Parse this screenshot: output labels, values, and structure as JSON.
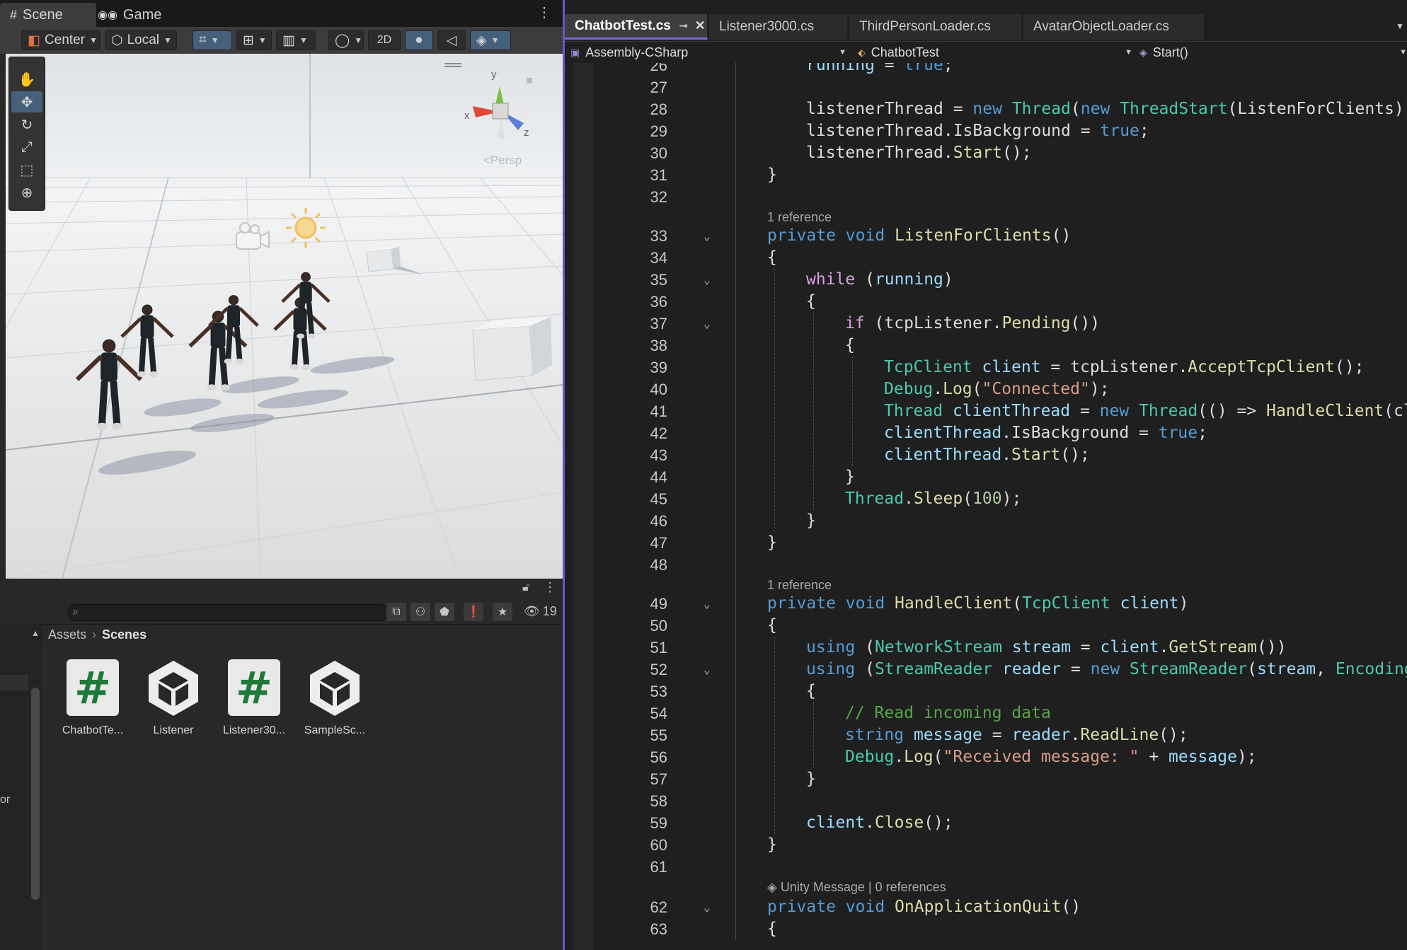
{
  "unity": {
    "tabs": {
      "scene": "Scene",
      "game": "Game"
    },
    "toolbar": {
      "pivot": "Center",
      "space": "Local",
      "mode2d": "2D"
    },
    "viewport": {
      "projection": "<Persp",
      "axis_x": "x",
      "axis_y": "y",
      "axis_z": "z"
    },
    "project": {
      "hidden_count": "19",
      "breadcrumb": {
        "root": "Assets",
        "current": "Scenes"
      },
      "assets": [
        {
          "name": "ChatbotTe...",
          "icon": "csharp-script-icon"
        },
        {
          "name": "Listener",
          "icon": "unity-scene-icon"
        },
        {
          "name": "Listener30...",
          "icon": "csharp-script-icon"
        },
        {
          "name": "SampleSc...",
          "icon": "unity-scene-icon"
        }
      ],
      "side_label": "or"
    }
  },
  "vs": {
    "tabs": [
      {
        "label": "ChatbotTest.cs",
        "active": true
      },
      {
        "label": "Listener3000.cs"
      },
      {
        "label": "ThirdPersonLoader.cs"
      },
      {
        "label": "AvatarObjectLoader.cs"
      }
    ],
    "nav": {
      "project": "Assembly-CSharp",
      "type": "ChatbotTest",
      "member": "Start()"
    },
    "lens": {
      "ref1": "1 reference",
      "ref2": "1 reference",
      "unity_message": "Unity Message | 0 references"
    },
    "lines": [
      {
        "n": "26",
        "text": "running = true;"
      },
      {
        "n": "27",
        "text": ""
      },
      {
        "n": "28",
        "text": "listenerThread = new Thread(new ThreadStart(ListenForClients));"
      },
      {
        "n": "29",
        "text": "listenerThread.IsBackground = true;"
      },
      {
        "n": "30",
        "text": "listenerThread.Start();"
      },
      {
        "n": "31",
        "text": "}"
      },
      {
        "n": "32",
        "text": ""
      },
      {
        "n": "33",
        "text": "private void ListenForClients()"
      },
      {
        "n": "34",
        "text": "{"
      },
      {
        "n": "35",
        "text": "while (running)"
      },
      {
        "n": "36",
        "text": "{"
      },
      {
        "n": "37",
        "text": "if (tcpListener.Pending())"
      },
      {
        "n": "38",
        "text": "{"
      },
      {
        "n": "39",
        "text": "TcpClient client = tcpListener.AcceptTcpClient();"
      },
      {
        "n": "40",
        "text": "Debug.Log(\"Connected\");"
      },
      {
        "n": "41",
        "text": "Thread clientThread = new Thread(() => HandleClient(cl"
      },
      {
        "n": "42",
        "text": "clientThread.IsBackground = true;"
      },
      {
        "n": "43",
        "text": "clientThread.Start();"
      },
      {
        "n": "44",
        "text": "}"
      },
      {
        "n": "45",
        "text": "Thread.Sleep(100);"
      },
      {
        "n": "46",
        "text": "}"
      },
      {
        "n": "47",
        "text": "}"
      },
      {
        "n": "48",
        "text": ""
      },
      {
        "n": "49",
        "text": "private void HandleClient(TcpClient client)"
      },
      {
        "n": "50",
        "text": "{"
      },
      {
        "n": "51",
        "text": "using (NetworkStream stream = client.GetStream())"
      },
      {
        "n": "52",
        "text": "using (StreamReader reader = new StreamReader(stream, Encoding"
      },
      {
        "n": "53",
        "text": "{"
      },
      {
        "n": "54",
        "text": "// Read incoming data"
      },
      {
        "n": "55",
        "text": "string message = reader.ReadLine();"
      },
      {
        "n": "56",
        "text": "Debug.Log(\"Received message: \" + message);"
      },
      {
        "n": "57",
        "text": "}"
      },
      {
        "n": "58",
        "text": ""
      },
      {
        "n": "59",
        "text": "client.Close();"
      },
      {
        "n": "60",
        "text": "}"
      },
      {
        "n": "61",
        "text": ""
      },
      {
        "n": "62",
        "text": "private void OnApplicationQuit()"
      },
      {
        "n": "63",
        "text": "{"
      }
    ]
  }
}
